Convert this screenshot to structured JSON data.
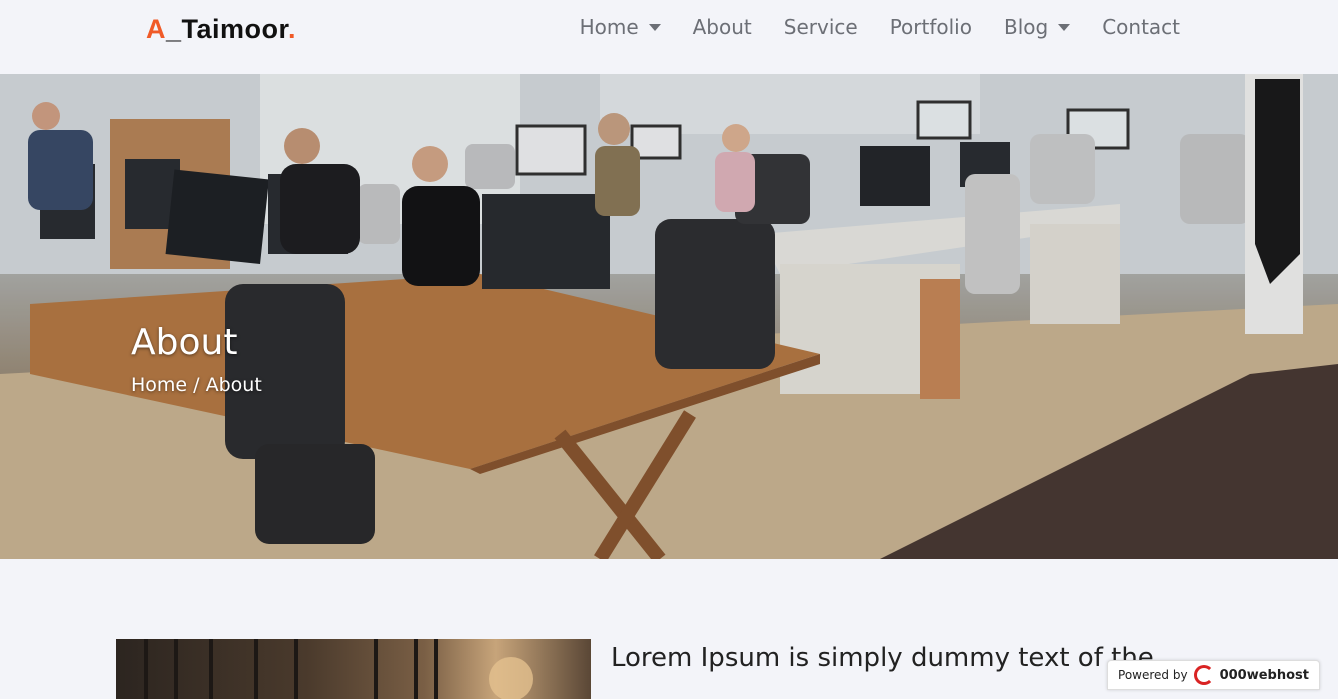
{
  "brand": {
    "prefix": "A",
    "rest": "_Taimoor",
    "suffix": "."
  },
  "nav": [
    {
      "label": "Home",
      "dropdown": true
    },
    {
      "label": "About",
      "dropdown": false
    },
    {
      "label": "Service",
      "dropdown": false
    },
    {
      "label": "Portfolio",
      "dropdown": false
    },
    {
      "label": "Blog",
      "dropdown": true
    },
    {
      "label": "Contact",
      "dropdown": false
    }
  ],
  "hero": {
    "title": "About",
    "breadcrumb": {
      "home": "Home",
      "separator": "/",
      "current": "About"
    }
  },
  "about": {
    "heading": "Lorem Ipsum is simply dummy text of the"
  },
  "footer_badge": {
    "prefix": "Powered by",
    "brand": "000webhost"
  },
  "colors": {
    "accent": "#f05a28",
    "background": "#f3f4f9",
    "nav_text": "#6c6f76"
  }
}
